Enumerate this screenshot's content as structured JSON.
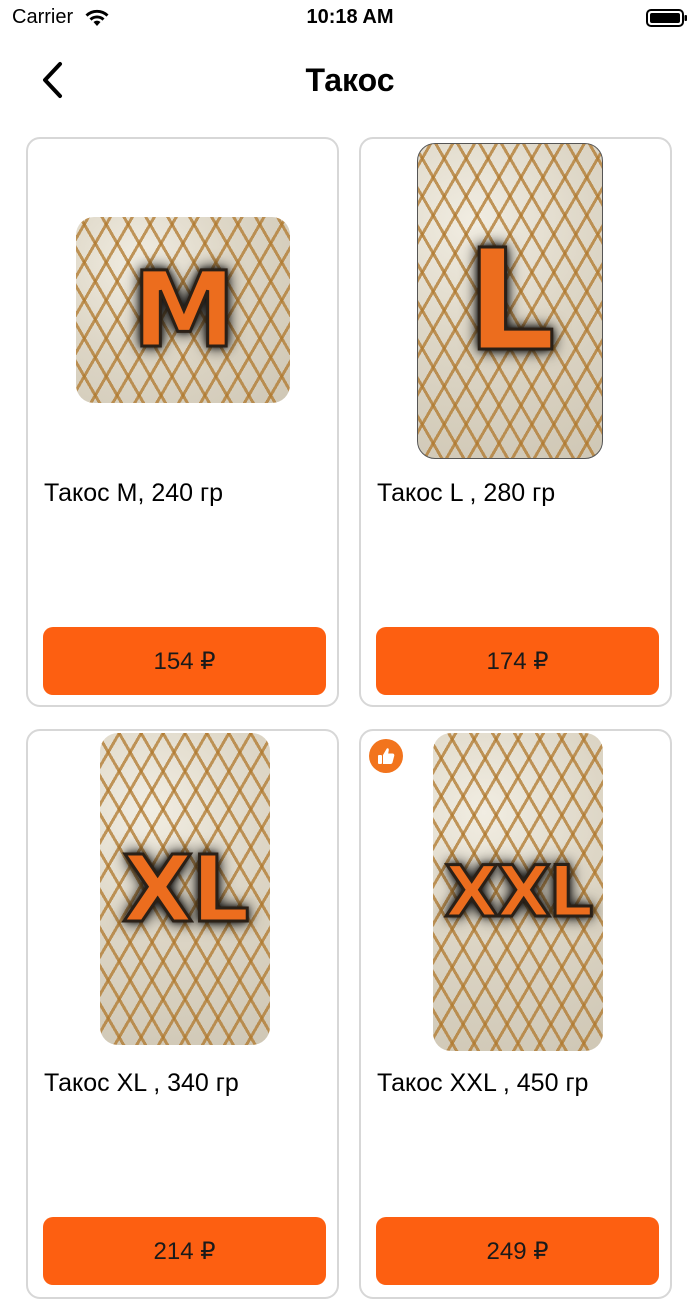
{
  "status_bar": {
    "carrier": "Carrier",
    "time": "10:18 AM"
  },
  "nav": {
    "title": "Такос",
    "back_icon": "chevron-left-icon"
  },
  "colors": {
    "accent": "#fd5f11",
    "badge": "#f2741d",
    "card_border": "#d7d7d7"
  },
  "products": [
    {
      "image_label": "M",
      "title": "Такос M, 240 гр",
      "price": "154 ₽",
      "liked": false
    },
    {
      "image_label": "L",
      "title": "Такос L , 280 гр",
      "price": "174 ₽",
      "liked": false
    },
    {
      "image_label": "XL",
      "title": "Такос XL , 340 гр",
      "price": "214 ₽",
      "liked": false
    },
    {
      "image_label": "XXL",
      "title": "Такос XXL , 450 гр",
      "price": "249 ₽",
      "liked": true
    }
  ]
}
